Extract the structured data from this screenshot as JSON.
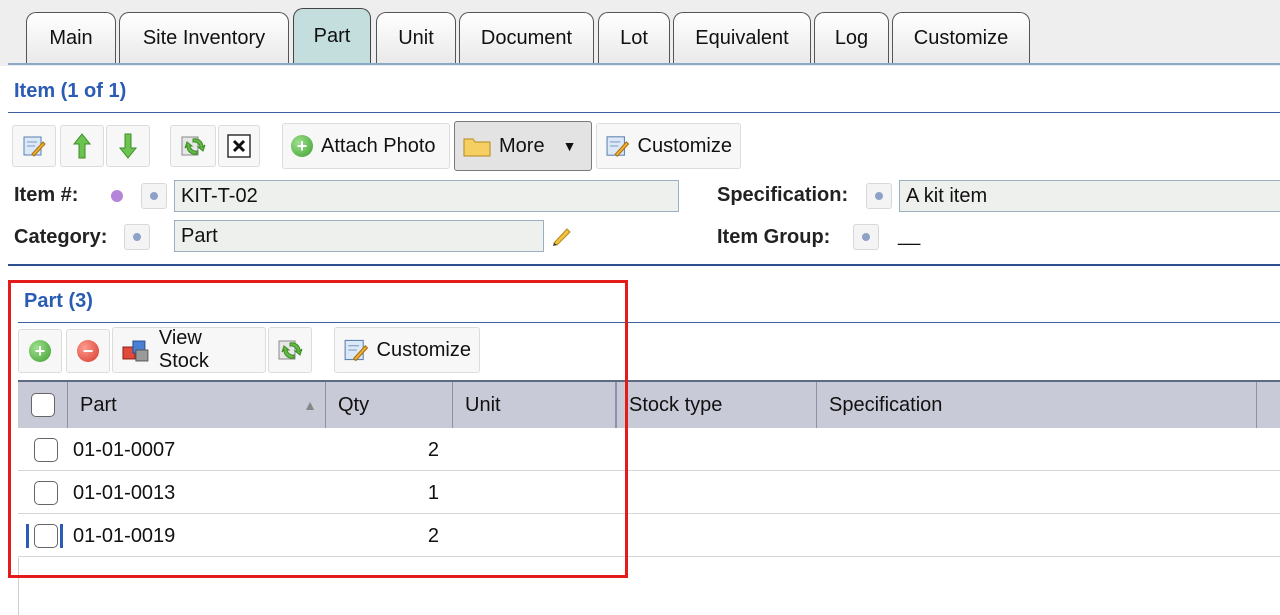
{
  "tabs": [
    "Main",
    "Site Inventory",
    "Part",
    "Unit",
    "Document",
    "Lot",
    "Equivalent",
    "Log",
    "Customize"
  ],
  "active_tab": "Part",
  "item_section": {
    "title": "Item (1 of 1)",
    "toolbar": {
      "attach_photo_label": "Attach Photo",
      "more_label": "More",
      "customize_label": "Customize"
    },
    "fields": {
      "item_no_label": "Item #:",
      "item_no_value": "KIT-T-02",
      "category_label": "Category:",
      "category_value": "Part",
      "specification_label": "Specification:",
      "specification_value": "A kit item",
      "item_group_label": "Item Group:",
      "item_group_value": "__"
    }
  },
  "part_section": {
    "title": "Part (3)",
    "toolbar": {
      "view_stock_label": "View Stock",
      "customize_label": "Customize"
    },
    "columns": [
      "Part",
      "Qty",
      "Unit",
      "Stock type",
      "Specification"
    ],
    "sort_indicator": "▲",
    "rows": [
      {
        "part": "01-01-0007",
        "qty": "2"
      },
      {
        "part": "01-01-0013",
        "qty": "1"
      },
      {
        "part": "01-01-0019",
        "qty": "2"
      }
    ]
  },
  "colors": {
    "accent": "#2a5bb5",
    "active_tab": "#c3dedd",
    "highlight_box": "#e31b1b",
    "grid_header": "#c9cad8"
  }
}
